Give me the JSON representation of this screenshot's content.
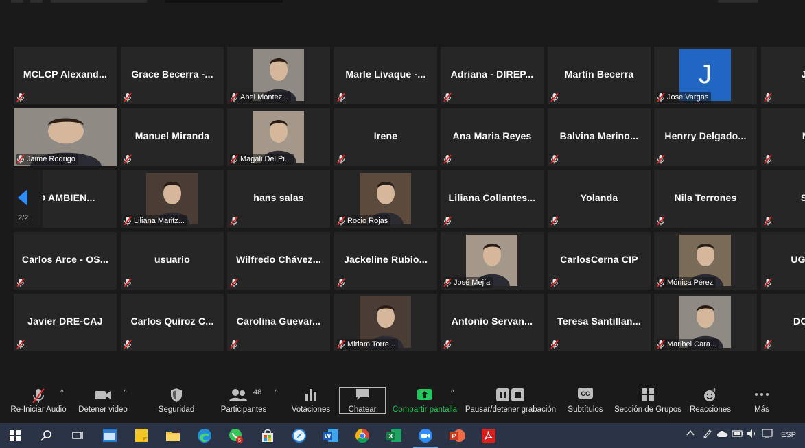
{
  "pager": {
    "label": "2/2"
  },
  "tiles": [
    {
      "name": "MCLCP  Alexand...",
      "video": false,
      "footer": ""
    },
    {
      "name": "Grace  Becerra  -...",
      "video": false,
      "footer": ""
    },
    {
      "name": "",
      "video": true,
      "footer": "Abel Montez..."
    },
    {
      "name": "Marle  Livaque  -...",
      "video": false,
      "footer": ""
    },
    {
      "name": "Adriana  -  DIREP...",
      "video": false,
      "footer": ""
    },
    {
      "name": "Martín Becerra",
      "video": false,
      "footer": ""
    },
    {
      "name": "",
      "video": true,
      "letter": "J",
      "footer": "Jose Vargas"
    },
    {
      "name": "Jose",
      "video": false,
      "footer": ""
    },
    {
      "name": "",
      "video": true,
      "full": true,
      "footer": "Jaime Rodrigo"
    },
    {
      "name": "Manuel Miranda",
      "video": false,
      "footer": ""
    },
    {
      "name": "",
      "video": true,
      "footer": "Magali Del Pi..."
    },
    {
      "name": "Irene",
      "video": false,
      "footer": ""
    },
    {
      "name": "Ana Maria Reyes",
      "video": false,
      "footer": ""
    },
    {
      "name": "Balvina  Merino...",
      "video": false,
      "footer": ""
    },
    {
      "name": "Henrry  Delgado...",
      "video": false,
      "footer": ""
    },
    {
      "name": "Nels",
      "video": false,
      "footer": ""
    },
    {
      "name": "IO  AMBIEN...",
      "video": false,
      "footer": ""
    },
    {
      "name": "",
      "video": true,
      "footer": "Liliana Maritz..."
    },
    {
      "name": "hans salas",
      "video": false,
      "footer": ""
    },
    {
      "name": "",
      "video": true,
      "footer": "Rocio Rojas"
    },
    {
      "name": "Liliana  Collantes...",
      "video": false,
      "footer": ""
    },
    {
      "name": "Yolanda",
      "video": false,
      "footer": ""
    },
    {
      "name": "Nila Terrones",
      "video": false,
      "footer": ""
    },
    {
      "name": "Susy",
      "video": false,
      "footer": ""
    },
    {
      "name": "Carlos  Arce  -  OS...",
      "video": false,
      "footer": ""
    },
    {
      "name": "usuario",
      "video": false,
      "footer": ""
    },
    {
      "name": "Wilfredo  Chávez...",
      "video": false,
      "footer": ""
    },
    {
      "name": "Jackeline  Rubio...",
      "video": false,
      "footer": ""
    },
    {
      "name": "",
      "video": true,
      "footer": "José Mejía"
    },
    {
      "name": "CarlosCerna CIP",
      "video": false,
      "footer": ""
    },
    {
      "name": "",
      "video": true,
      "footer": "Mónica Pérez"
    },
    {
      "name": "UGEL SA",
      "video": false,
      "footer": ""
    },
    {
      "name": "Javier DRE-CAJ",
      "video": false,
      "footer": ""
    },
    {
      "name": "Carlos  Quiroz  C...",
      "video": false,
      "footer": ""
    },
    {
      "name": "Carolina  Guevar...",
      "video": false,
      "footer": ""
    },
    {
      "name": "",
      "video": true,
      "footer": "Miriam Torre..."
    },
    {
      "name": "Antonio  Servan...",
      "video": false,
      "footer": ""
    },
    {
      "name": "Teresa  Santillan...",
      "video": false,
      "footer": ""
    },
    {
      "name": "",
      "video": true,
      "footer": "Maribel Cara..."
    },
    {
      "name": "DORA U",
      "video": false,
      "footer": ""
    }
  ],
  "toolbar": {
    "audio": "Re-Iniciar Audio",
    "video": "Detener video",
    "security": "Seguridad",
    "participants": "Participantes",
    "participants_count": "48",
    "polls": "Votaciones",
    "chat": "Chatear",
    "share": "Compartir pantalla",
    "record": "Pausar/detener grabación",
    "subtitles": "Subtítulos",
    "groups": "Sección de Grupos",
    "reactions": "Reacciones",
    "more": "Más",
    "cc_glyph": "CC"
  },
  "taskbar": {
    "lang": "ESP"
  },
  "colors": {
    "accent_blue": "#2d8cff",
    "share_green": "#22c55e",
    "mute_red": "#e02828",
    "tile_bg": "#262626"
  }
}
